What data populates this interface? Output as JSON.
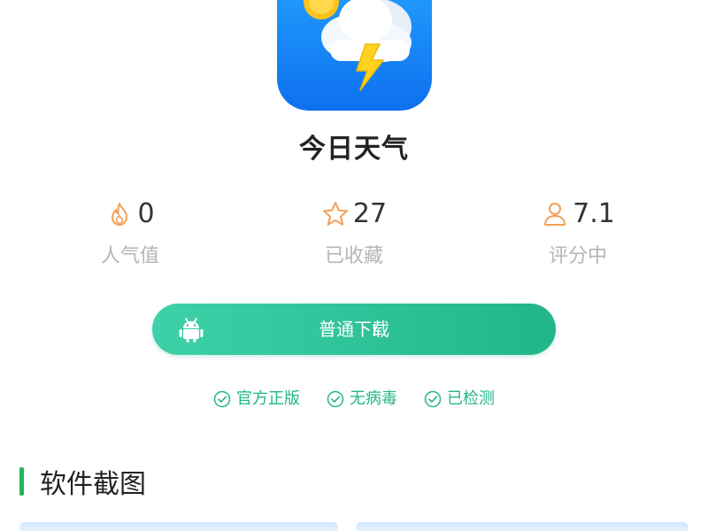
{
  "app": {
    "name": "今日天气",
    "icon": "weather-cloud-lightning-icon",
    "brand_color": "#1a8cff"
  },
  "stats": [
    {
      "icon": "flame-icon",
      "value": "0",
      "label": "人气值",
      "color": "#f0a05a"
    },
    {
      "icon": "star-icon",
      "value": "27",
      "label": "已收藏",
      "color": "#f0a05a"
    },
    {
      "icon": "user-icon",
      "value": "7.1",
      "label": "评分中",
      "color": "#f0a05a"
    }
  ],
  "download": {
    "label": "普通下载",
    "icon": "android-icon",
    "color": "#2cc397"
  },
  "badges": [
    {
      "icon": "check-icon",
      "label": "官方正版"
    },
    {
      "icon": "check-icon",
      "label": "无病毒"
    },
    {
      "icon": "check-icon",
      "label": "已检测"
    }
  ],
  "section": {
    "title": "软件截图",
    "accent": "#22b55a"
  }
}
